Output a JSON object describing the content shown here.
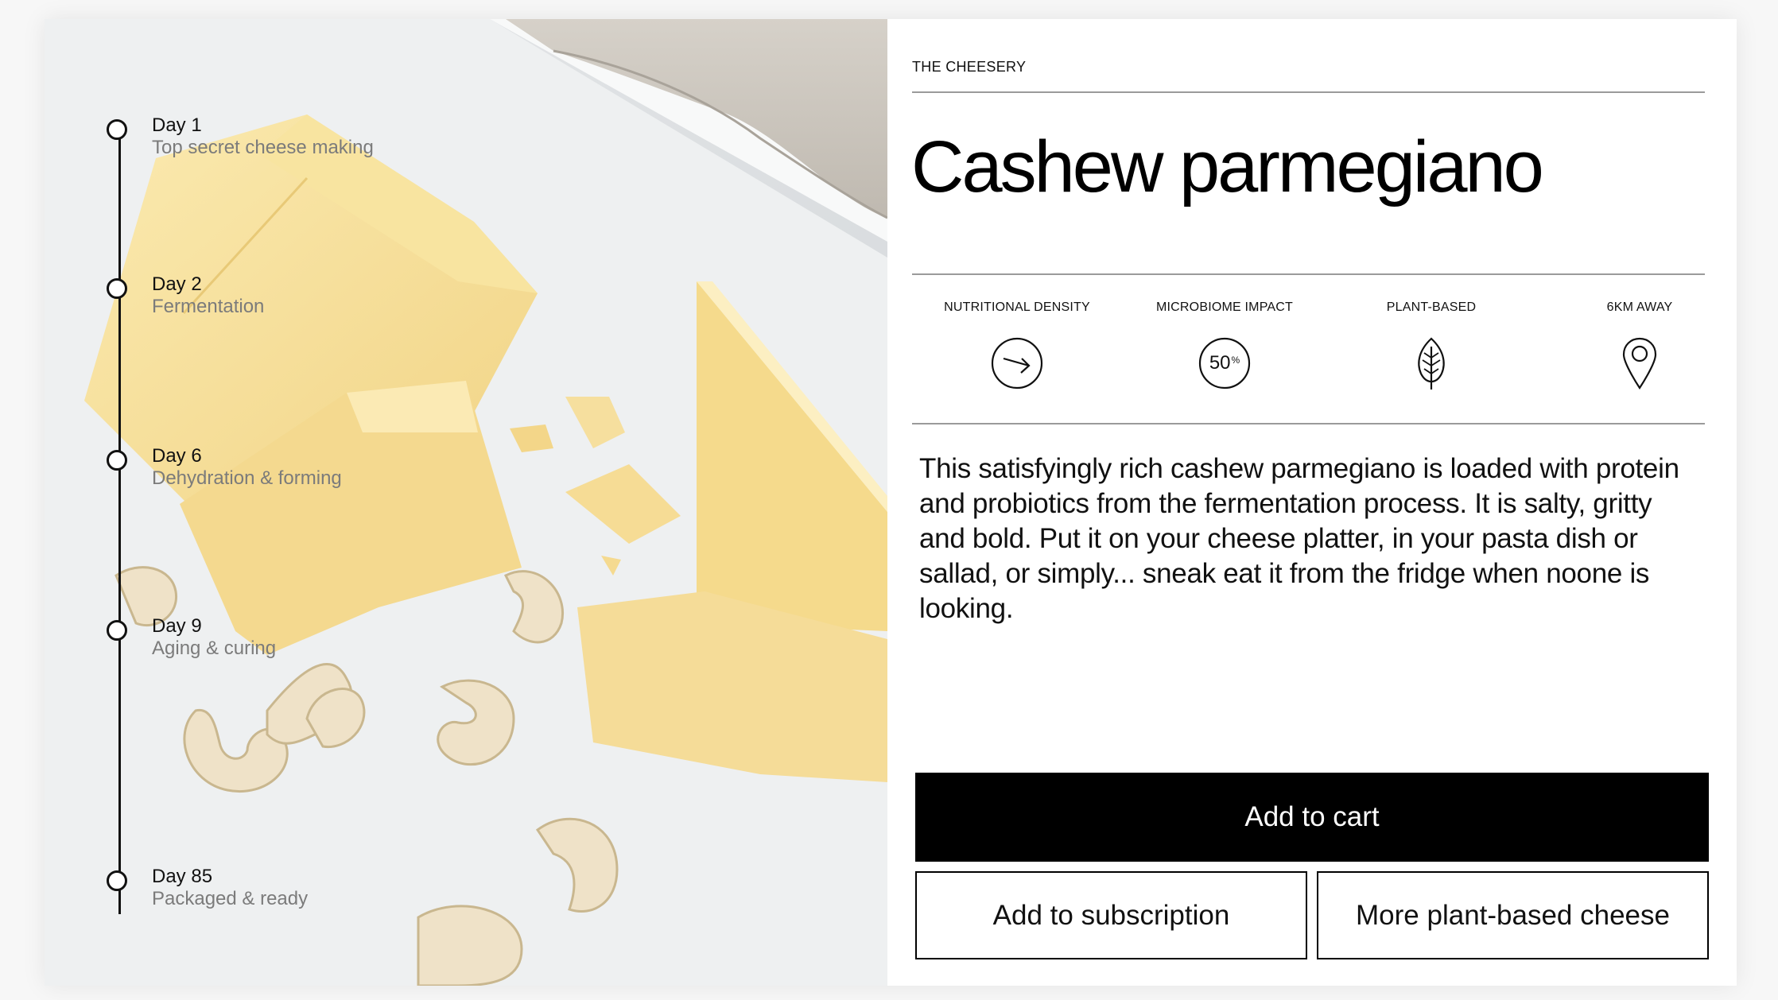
{
  "brand": "THE CHEESERY",
  "product": {
    "title": "Cashew parmegiano",
    "description": "This satisfyingly rich cashew parmegiano is loaded with protein and probiotics from the fermentation process. It is salty, gritty and bold. Put it on your cheese platter, in your pasta dish or sallad, or simply... sneak eat it from the fridge when noone is looking."
  },
  "attributes": [
    {
      "label": "NUTRITIONAL DENSITY",
      "icon": "arrow-right-circle-icon"
    },
    {
      "label": "MICROBIOME IMPACT",
      "icon": "percent-circle-icon",
      "value": "50",
      "unit": "%"
    },
    {
      "label": "PLANT-BASED",
      "icon": "leaf-icon"
    },
    {
      "label": "6KM AWAY",
      "icon": "location-pin-icon"
    }
  ],
  "timeline": [
    {
      "day": "Day 1",
      "desc": "Top secret cheese making"
    },
    {
      "day": "Day 2",
      "desc": "Fermentation"
    },
    {
      "day": "Day 6",
      "desc": "Dehydration & forming"
    },
    {
      "day": "Day 9",
      "desc": "Aging & curing"
    },
    {
      "day": "Day 85",
      "desc": "Packaged & ready"
    }
  ],
  "actions": {
    "add_to_cart": "Add to cart",
    "add_to_subscription": "Add to subscription",
    "more": "More plant-based cheese"
  },
  "colors": {
    "primary_button": "#000000",
    "text": "#111111",
    "muted_text": "#7b7b7b",
    "cheese": "#f6df9c",
    "cashew": "#efe2c8"
  }
}
